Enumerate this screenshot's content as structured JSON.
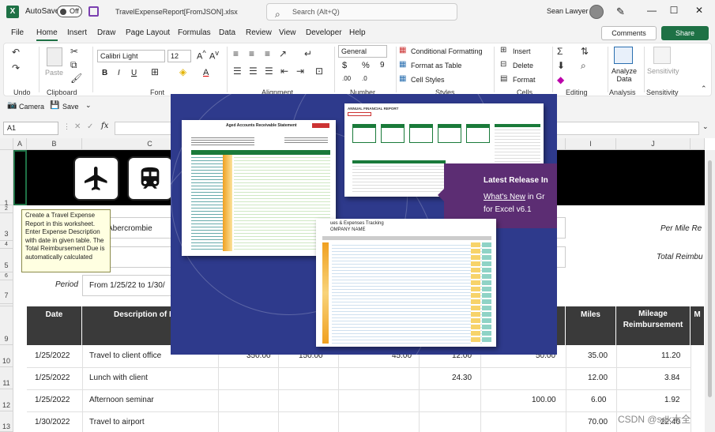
{
  "titlebar": {
    "autosave_label": "AutoSave",
    "autosave_state": "Off",
    "filename": "TravelExpenseReport[FromJSON].xlsx",
    "search_placeholder": "Search (Alt+Q)",
    "user_name": "Sean Lawyer"
  },
  "menu": {
    "tabs": [
      "File",
      "Home",
      "Insert",
      "Draw",
      "Page Layout",
      "Formulas",
      "Data",
      "Review",
      "View",
      "Developer",
      "Help"
    ],
    "active": "Home",
    "comments_label": "Comments",
    "share_label": "Share"
  },
  "ribbon": {
    "groups": {
      "undo": "Undo",
      "clipboard": "Clipboard",
      "font": "Font",
      "alignment": "Alignment",
      "number": "Number",
      "styles": "Styles",
      "cells": "Cells",
      "editing": "Editing",
      "analysis": "Analysis",
      "sensitivity": "Sensitivity"
    },
    "paste_label": "Paste",
    "font_name": "Calibri Light",
    "font_size": "12",
    "number_format": "General",
    "conditional_formatting": "Conditional Formatting",
    "format_as_table": "Format as Table",
    "cell_styles": "Cell Styles",
    "insert": "Insert",
    "delete": "Delete",
    "format": "Format",
    "analyze_data": "Analyze Data",
    "sensitivity_btn": "Sensitivity"
  },
  "quick_access": {
    "camera": "Camera",
    "save": "Save"
  },
  "formula_bar": {
    "name_box": "A1",
    "fx": "fx"
  },
  "sheet": {
    "columns": [
      "A",
      "B",
      "C",
      "I",
      "J"
    ],
    "rows": [
      "1",
      "2",
      "3",
      "4",
      "5",
      "6",
      "7",
      "8",
      "9",
      "10",
      "11",
      "12",
      "13"
    ],
    "tooltip": "Create a Travel Expense Report in this worksheet. Enter Expense Description with date in given table. The Total Reimbursement Due is automatically calculated",
    "name_partial": "Abercrombie",
    "per_mile_label": "Per Mile Re",
    "total_reimb_label": "Total Reimbu",
    "period_label": "Period",
    "period_value": "From 1/25/22 to 1/30/",
    "headers": {
      "date": "Date",
      "description": "Description of Ex",
      "miles": "Miles",
      "mileage_reimb": "Mileage Reimbursement",
      "m": "M"
    },
    "rows_data": [
      {
        "date": "1/25/2022",
        "desc": "Travel to client office",
        "v1": "350.00",
        "v2": "150.00",
        "v3": "45.00",
        "v4": "12.00",
        "v5": "50.00",
        "miles": "35.00",
        "reimb": "11.20"
      },
      {
        "date": "1/25/2022",
        "desc": "Lunch with client",
        "v1": "",
        "v2": "",
        "v3": "",
        "v4": "24.30",
        "v5": "",
        "miles": "12.00",
        "reimb": "3.84"
      },
      {
        "date": "1/25/2022",
        "desc": "Afternoon seminar",
        "v1": "",
        "v2": "",
        "v3": "",
        "v4": "",
        "v5": "100.00",
        "miles": "6.00",
        "reimb": "1.92"
      },
      {
        "date": "1/30/2022",
        "desc": "Travel to airport",
        "v1": "",
        "v2": "",
        "v3": "",
        "v4": "",
        "v5": "",
        "miles": "70.00",
        "reimb": "22.40"
      }
    ]
  },
  "overlay": {
    "thumb1_title": "Aged Accounts Receivable Statement",
    "thumb2_title": "ANNUAL FINANCIAL REPORT",
    "thumb3_title": "ues & Expenses Tracking",
    "thumb3_sub": "OMPANY NAME",
    "promo_title": "Latest Release In",
    "promo_link": "What's New",
    "promo_rest": " in Gr",
    "promo_line3": "for Excel v6.1"
  },
  "watermark": "CSDN @sdk大全"
}
